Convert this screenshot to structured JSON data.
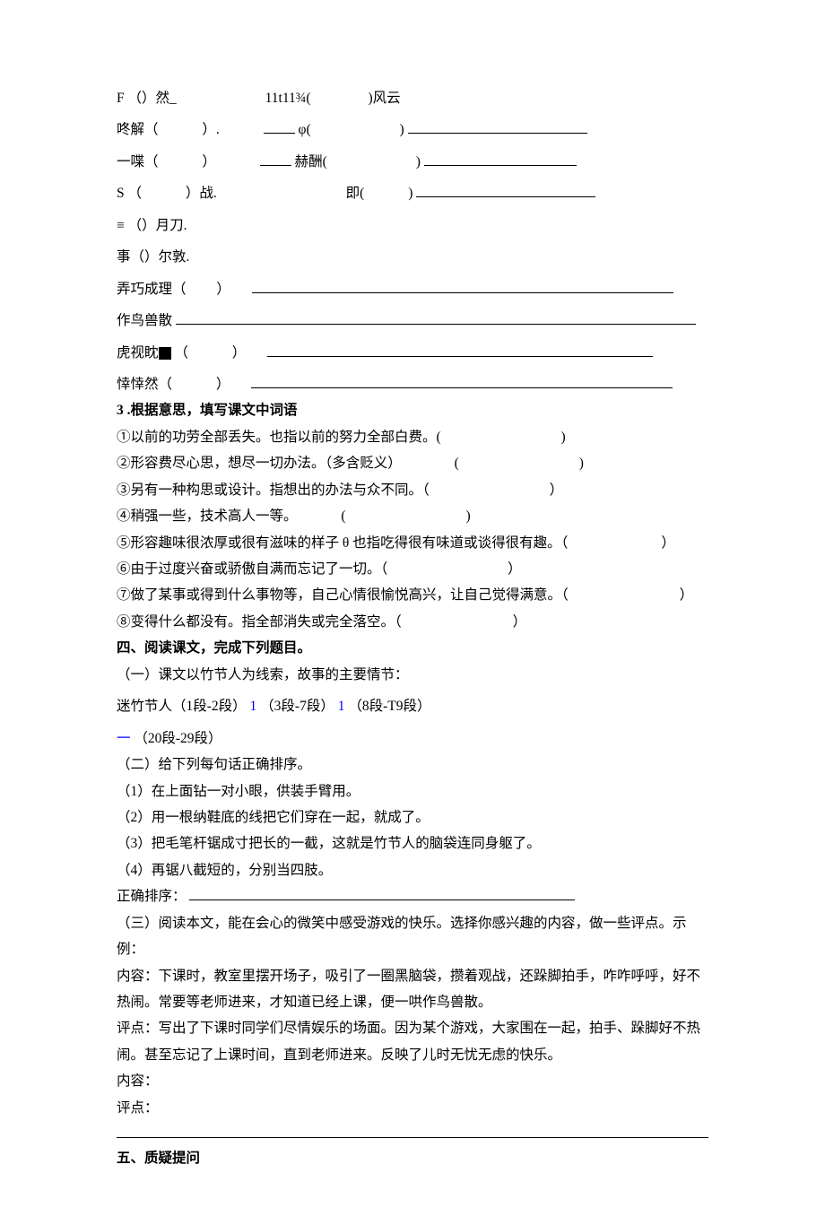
{
  "rows": {
    "r1a": "F （）然_",
    "r1b": "11t11¾(",
    "r1c": ")风云",
    "r2a": "咚解（",
    "r2b": "）.",
    "r2c": "φ(",
    "r2d": ")",
    "r3a": "一喋（",
    "r3b": "）",
    "r3c": "赫酬(",
    "r3d": ")",
    "r4a": "S （",
    "r4b": "）战.",
    "r4c": "即(",
    "r4d": ")",
    "r5": "≡ （）月刀.",
    "r6": "事（）尔敦.",
    "r7a": "弄巧成理（",
    "r7b": "）",
    "r8": "作鸟兽散",
    "r9a": "虎视眈",
    "r9b": "（",
    "r9c": "）",
    "r10a": "悻悻然（",
    "r10b": "）"
  },
  "sec3_title": "3 .根据意思，填写课文中词语",
  "sec3": {
    "i1": "①以前的功劳全部丢失。也指以前的努力全部白费。(",
    "i2": "②形容费尽心思，想尽一切办法。（多含贬义）",
    "i3": "③另有一种构思或设计。指想出的办法与众不同。（",
    "i4": "④稍强一些，技术高人一等。",
    "i5": "⑤形容趣味很浓厚或很有滋味的样子 θ 也指吃得很有味道或谈得很有趣。（",
    "i6": "⑥由于过度兴奋或骄傲自满而忘记了一切。（",
    "i7": "⑦做了某事或得到什么事物等，自己心情很愉悦高兴，让自己觉得满意。（",
    "i8": "⑧变得什么都没有。指全部消失或完全落空。（",
    "lp": "(",
    "rp": ")",
    "rp_cn": "）"
  },
  "sec4": {
    "title": "四、阅读课文，完成下列题目。",
    "p1": "（一）课文以竹节人为线索，故事的主要情节：",
    "p2a": "迷竹节人（1段-2段）",
    "p2b": "1",
    "p2c": "（3段-7段）",
    "p2d": "1",
    "p2e": "（8段-T9段）",
    "p3a": "一",
    "p3b": "（20段-29段）",
    "p4": "（二）给下列每句话正确排序。",
    "s1": "（1）在上面钻一对小眼，供装手臂用。",
    "s2": "（2）用一根纳鞋底的线把它们穿在一起，就成了。",
    "s3": "（3）把毛笔杆锯成寸把长的一截，这就是竹节人的脑袋连同身躯了。",
    "s4": "（4）再锯八截短的，分别当四肢。",
    "order": "正确排序：",
    "p5a": "（三）阅读本文，能在会心的微笑中感受游戏的快乐。选择你感兴趣的内容，做一些评点。示例：",
    "p5b": "内容：下课时，教室里摆开场子，吸引了一圈黑脑袋，攒着观战，还跺脚拍手，咋咋呼呼，好不热闹。常要等老师进来，才知道已经上课，便一哄作鸟兽散。",
    "p5c": "评点：写出了下课时同学们尽情娱乐的场面。因为某个游戏，大家围在一起，拍手、跺脚好不热闹。甚至忘记了上课时间，直到老师进来。反映了儿时无忧无虑的快乐。",
    "content_label": "内容：",
    "comment_label": "评点："
  },
  "sec5_title": "五、质疑提问"
}
